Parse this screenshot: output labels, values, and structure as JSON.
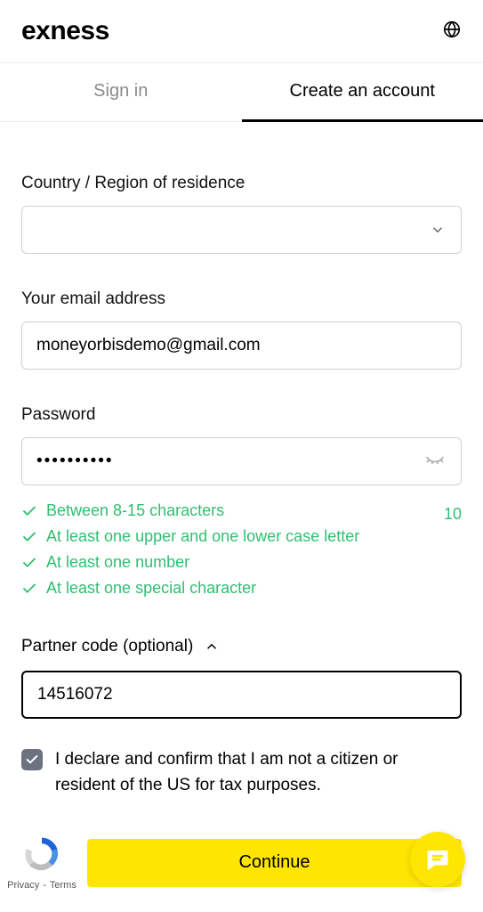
{
  "header": {
    "logo_text": "exness"
  },
  "tabs": {
    "signin": "Sign in",
    "create": "Create an account"
  },
  "form": {
    "country_label": "Country / Region of residence",
    "country_value": "",
    "email_label": "Your email address",
    "email_value": "moneyorbisdemo@gmail.com",
    "password_label": "Password",
    "password_value": "••••••••••",
    "password_char_count": "10",
    "rules": [
      "Between 8-15 characters",
      "At least one upper and one lower case letter",
      "At least one number",
      "At least one special character"
    ],
    "partner_label": "Partner code (optional)",
    "partner_value": "14516072",
    "declare_text": "I declare and confirm that I am not a citizen or resident of the US for tax purposes.",
    "continue_label": "Continue"
  },
  "recaptcha": {
    "privacy": "Privacy",
    "dash": "-",
    "terms": "Terms"
  }
}
